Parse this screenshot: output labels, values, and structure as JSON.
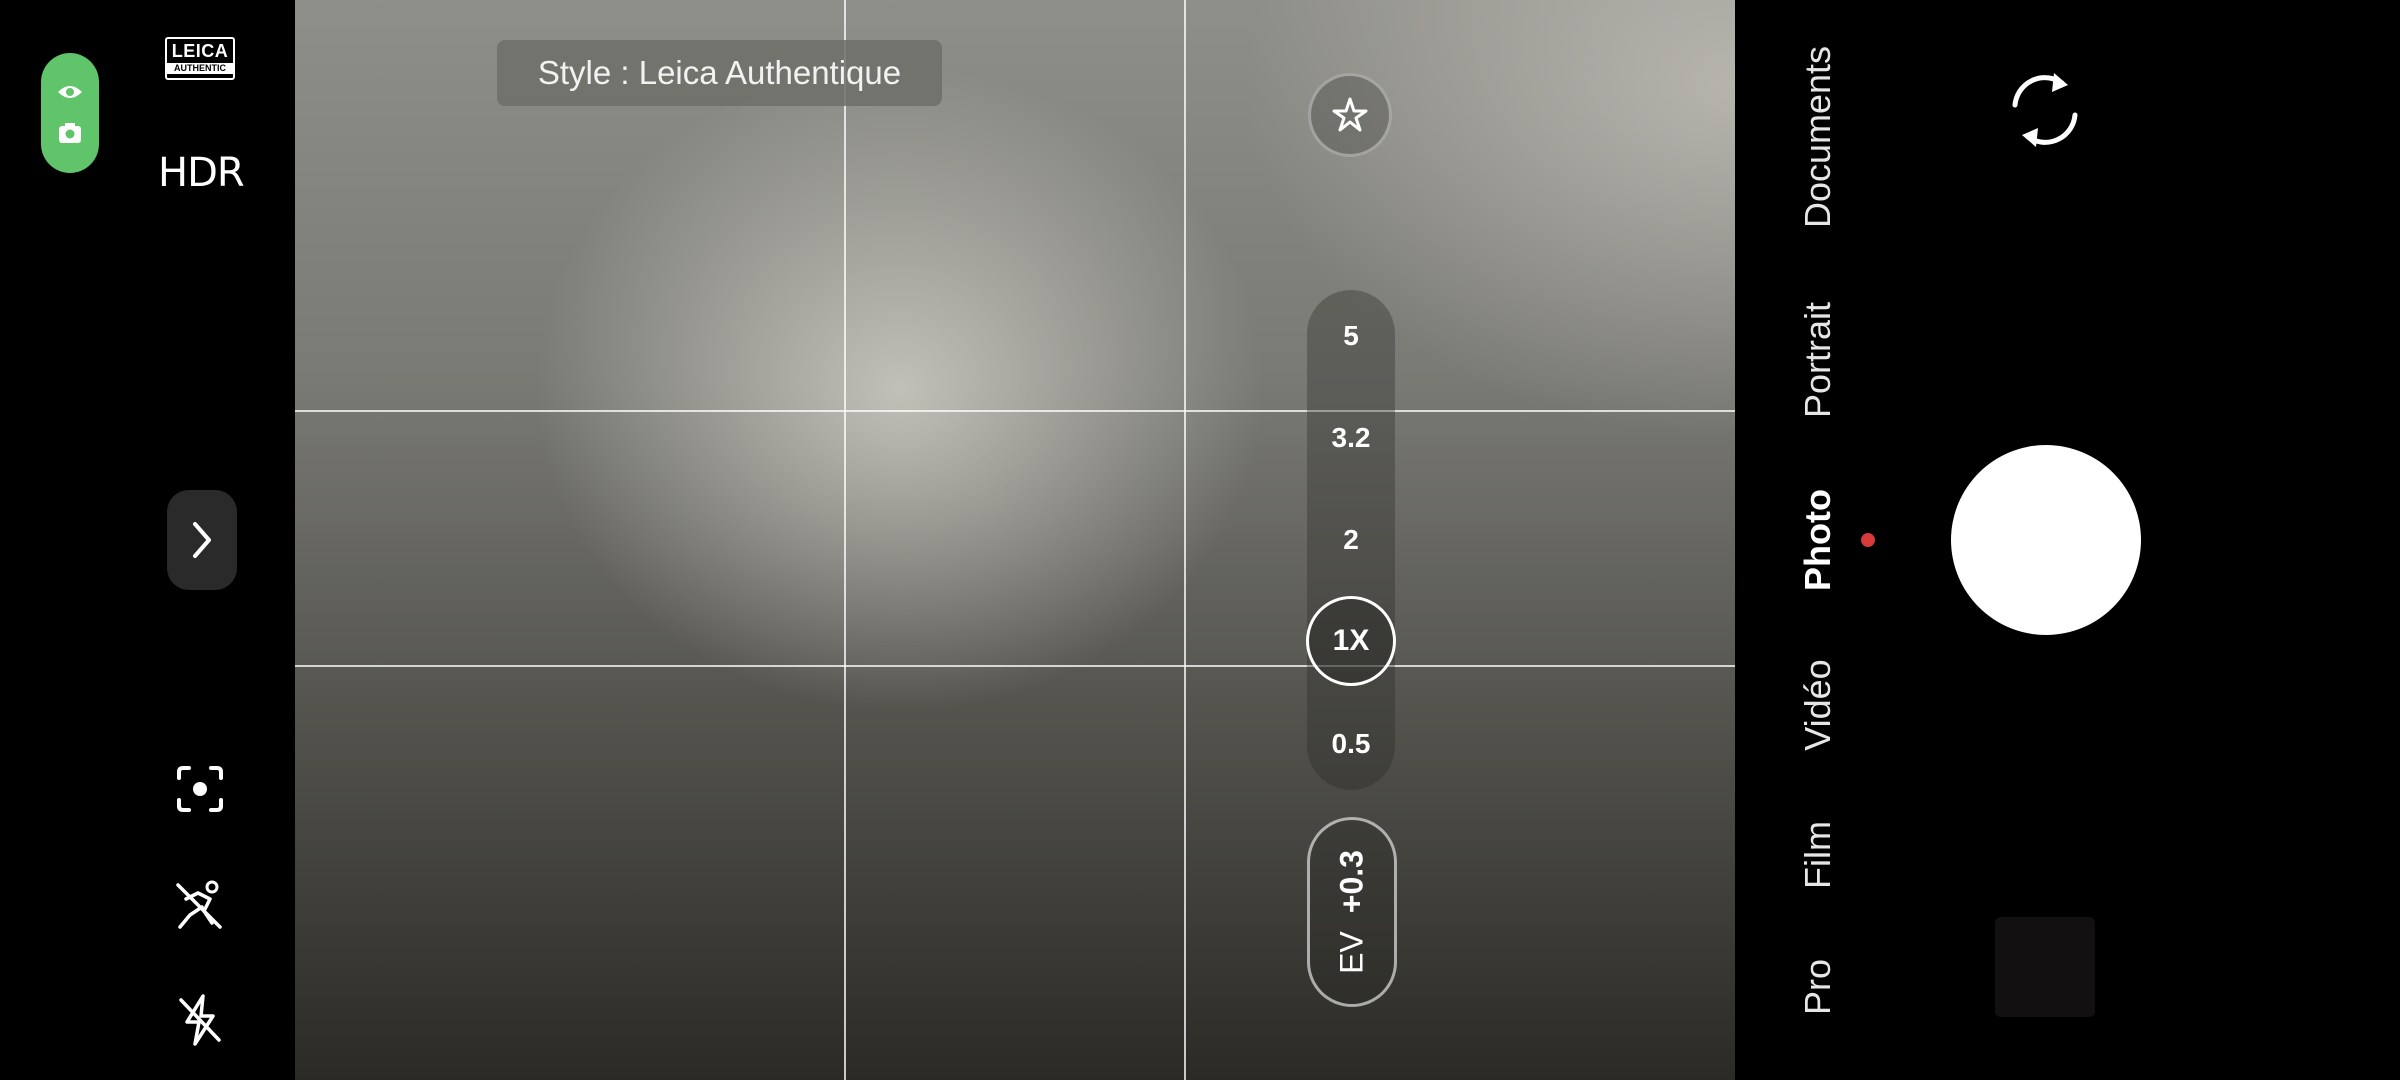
{
  "left_bar": {
    "leica_badge": {
      "line1": "LEICA",
      "line2": "AUTHENTIC"
    },
    "hdr_label": "HDR",
    "icons": [
      "privacy-indicator-icon",
      "lens-focus-icon",
      "motion-off-icon",
      "flash-off-icon",
      "chevron-right-icon"
    ]
  },
  "viewfinder": {
    "style_toast": "Style : Leica Authentique",
    "zoom_levels": [
      "5",
      "3.2",
      "2",
      "1X",
      "0.5"
    ],
    "selected_zoom": "1X",
    "ev": {
      "label": "EV",
      "value": "+0.3"
    },
    "icons": [
      "ai-enhance-icon"
    ]
  },
  "modes": {
    "items": [
      "Documents",
      "Portrait",
      "Photo",
      "Vidéo",
      "Film",
      "Pro"
    ],
    "active": "Photo"
  },
  "colors": {
    "privacy_pill": "#5fc46a",
    "active_mode_dot": "#d63a3a",
    "shutter": "#ffffff"
  }
}
